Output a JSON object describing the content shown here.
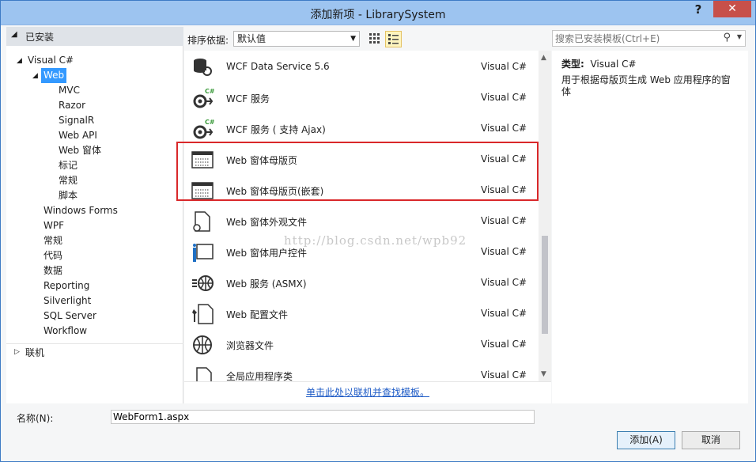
{
  "window": {
    "title": "添加新项 - LibrarySystem",
    "help": "?",
    "close": "✕"
  },
  "tree": {
    "installed": "已安装",
    "items": [
      {
        "label": "Visual C#",
        "level": 0,
        "expanded": true
      },
      {
        "label": "Web",
        "level": 1,
        "expanded": true,
        "selected": true
      },
      {
        "label": "MVC",
        "level": 2
      },
      {
        "label": "Razor",
        "level": 2
      },
      {
        "label": "SignalR",
        "level": 2
      },
      {
        "label": "Web API",
        "level": 2
      },
      {
        "label": "Web 窗体",
        "level": 2
      },
      {
        "label": "标记",
        "level": 2
      },
      {
        "label": "常规",
        "level": 2
      },
      {
        "label": "脚本",
        "level": 2
      },
      {
        "label": "Windows Forms",
        "level": 1
      },
      {
        "label": "WPF",
        "level": 1
      },
      {
        "label": "常规",
        "level": 1
      },
      {
        "label": "代码",
        "level": 1
      },
      {
        "label": "数据",
        "level": 1
      },
      {
        "label": "Reporting",
        "level": 1
      },
      {
        "label": "Silverlight",
        "level": 1
      },
      {
        "label": "SQL Server",
        "level": 1
      },
      {
        "label": "Workflow",
        "level": 1
      }
    ],
    "online": "联机"
  },
  "sort": {
    "label": "排序依据:",
    "value": "默认值"
  },
  "templates": [
    {
      "name": "WCF Data Service 5.6",
      "lang": "Visual C#",
      "icon": "data-service-icon"
    },
    {
      "name": "WCF 服务",
      "lang": "Visual C#",
      "icon": "wcf-service-icon"
    },
    {
      "name": "WCF 服务 ( 支持 Ajax)",
      "lang": "Visual C#",
      "icon": "wcf-service-icon"
    },
    {
      "name": "Web 窗体母版页",
      "lang": "Visual C#",
      "icon": "master-page-icon"
    },
    {
      "name": "Web 窗体母版页(嵌套)",
      "lang": "Visual C#",
      "icon": "master-page-icon"
    },
    {
      "name": "Web 窗体外观文件",
      "lang": "Visual C#",
      "icon": "skin-file-icon"
    },
    {
      "name": "Web 窗体用户控件",
      "lang": "Visual C#",
      "icon": "user-control-icon"
    },
    {
      "name": "Web 服务 (ASMX)",
      "lang": "Visual C#",
      "icon": "web-service-icon"
    },
    {
      "name": "Web 配置文件",
      "lang": "Visual C#",
      "icon": "config-file-icon"
    },
    {
      "name": "浏览器文件",
      "lang": "Visual C#",
      "icon": "browser-file-icon"
    },
    {
      "name": "全局应用程序类",
      "lang": "Visual C#",
      "icon": "global-class-icon"
    }
  ],
  "watermark": "http://blog.csdn.net/wpb92",
  "online_link": "单击此处以联机并查找模板。",
  "search": {
    "placeholder": "搜索已安装模板(Ctrl+E)"
  },
  "detail": {
    "type_label": "类型:",
    "type_value": "Visual C#",
    "description": "用于根据母版页生成 Web 应用程序的窗体"
  },
  "name_field": {
    "label": "名称(N):",
    "value": "WebForm1.aspx"
  },
  "buttons": {
    "add": "添加(A)",
    "cancel": "取消"
  },
  "colors": {
    "selection": "#3399ff",
    "highlight_box": "#d9282a",
    "titlebar": "#9dc4f0",
    "close": "#c7504a"
  }
}
